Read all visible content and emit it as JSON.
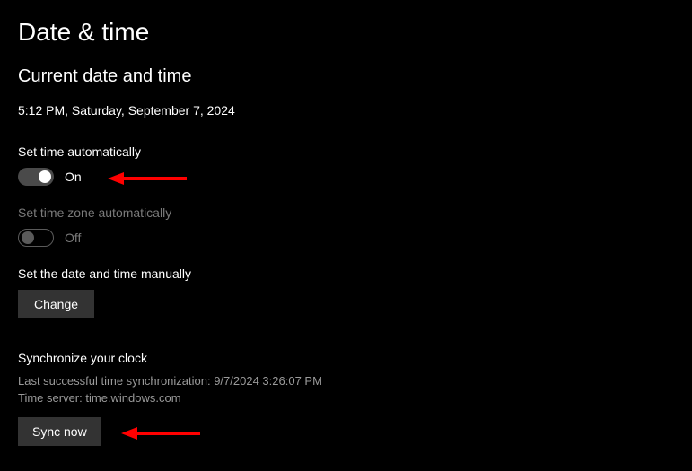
{
  "page": {
    "title": "Date & time"
  },
  "current": {
    "heading": "Current date and time",
    "value": "5:12 PM, Saturday, September 7, 2024"
  },
  "set_time_auto": {
    "label": "Set time automatically",
    "state": "On"
  },
  "set_tz_auto": {
    "label": "Set time zone automatically",
    "state": "Off"
  },
  "manual": {
    "label": "Set the date and time manually",
    "button": "Change"
  },
  "sync": {
    "heading": "Synchronize your clock",
    "last_sync": "Last successful time synchronization: 9/7/2024 3:26:07 PM",
    "server": "Time server: time.windows.com",
    "button": "Sync now"
  },
  "annotations": {
    "arrow_color": "#ff0000"
  }
}
